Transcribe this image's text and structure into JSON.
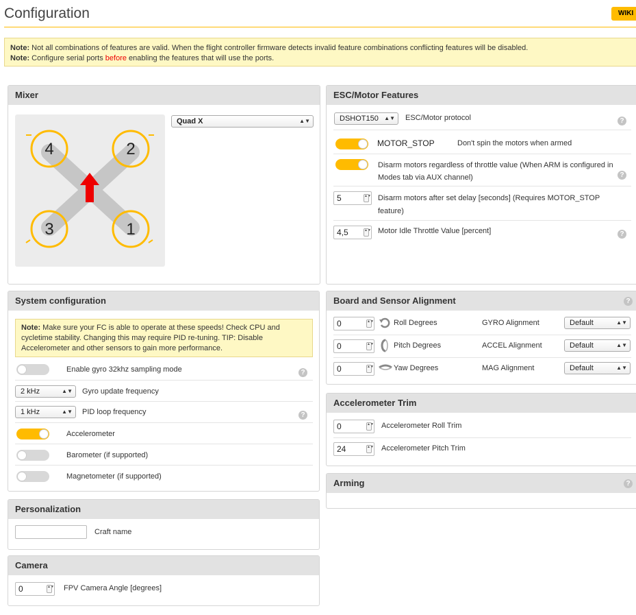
{
  "header": {
    "title": "Configuration",
    "wiki_label": "WIKI"
  },
  "notes": {
    "line1_prefix": "Note:",
    "line1_text": " Not all combinations of features are valid. When the flight controller firmware detects invalid feature combinations conflicting features will be disabled.",
    "line2_prefix": "Note:",
    "line2_a": " Configure serial ports ",
    "line2_red": "before",
    "line2_b": " enabling the features that will use the ports."
  },
  "mixer": {
    "title": "Mixer",
    "selected": "Quad X",
    "motors": [
      "4",
      "2",
      "3",
      "1"
    ]
  },
  "esc": {
    "title": "ESC/Motor Features",
    "protocol_value": "DSHOT150",
    "protocol_label": "ESC/Motor protocol",
    "motor_stop_name": "MOTOR_STOP",
    "motor_stop_desc": "Don't spin the motors when armed",
    "disarm_label": "Disarm motors regardless of throttle value (When ARM is configured in Modes tab via AUX channel)",
    "disarm_delay_value": "5",
    "disarm_delay_label": "Disarm motors after set delay [seconds] (Requires MOTOR_STOP feature)",
    "idle_value": "4,5",
    "idle_label": "Motor Idle Throttle Value [percent]"
  },
  "system": {
    "title": "System configuration",
    "note_prefix": "Note:",
    "note_text": " Make sure your FC is able to operate at these speeds! Check CPU and cycletime stability. Changing this may require PID re-tuning. TIP: Disable Accelerometer and other sensors to gain more performance.",
    "gyro32_label": "Enable gyro 32khz sampling mode",
    "gyro_freq_value": "2 kHz",
    "gyro_freq_label": "Gyro update frequency",
    "pid_freq_value": "1 kHz",
    "pid_freq_label": "PID loop frequency",
    "accel_label": "Accelerometer",
    "baro_label": "Barometer (if supported)",
    "mag_label": "Magnetometer (if supported)"
  },
  "board": {
    "title": "Board and Sensor Alignment",
    "roll_value": "0",
    "roll_label": "Roll Degrees",
    "pitch_value": "0",
    "pitch_label": "Pitch Degrees",
    "yaw_value": "0",
    "yaw_label": "Yaw Degrees",
    "gyro_align_label": "GYRO Alignment",
    "gyro_align_value": "Default",
    "accel_align_label": "ACCEL Alignment",
    "accel_align_value": "Default",
    "mag_align_label": "MAG Alignment",
    "mag_align_value": "Default"
  },
  "accel_trim": {
    "title": "Accelerometer Trim",
    "roll_value": "0",
    "roll_label": "Accelerometer Roll Trim",
    "pitch_value": "24",
    "pitch_label": "Accelerometer Pitch Trim"
  },
  "arming": {
    "title": "Arming"
  },
  "personal": {
    "title": "Personalization",
    "craft_value": "",
    "craft_label": "Craft name"
  },
  "camera": {
    "title": "Camera",
    "angle_value": "0",
    "angle_label": "FPV Camera Angle [degrees]"
  },
  "colors": {
    "accent": "#ffbb00",
    "note_bg": "#fef8c4",
    "panel_head": "#e2e2e2",
    "arrow": "#ee0000"
  },
  "help_glyph": "?",
  "select_arrow": "▲▼",
  "spin_glyph": "▲▼"
}
